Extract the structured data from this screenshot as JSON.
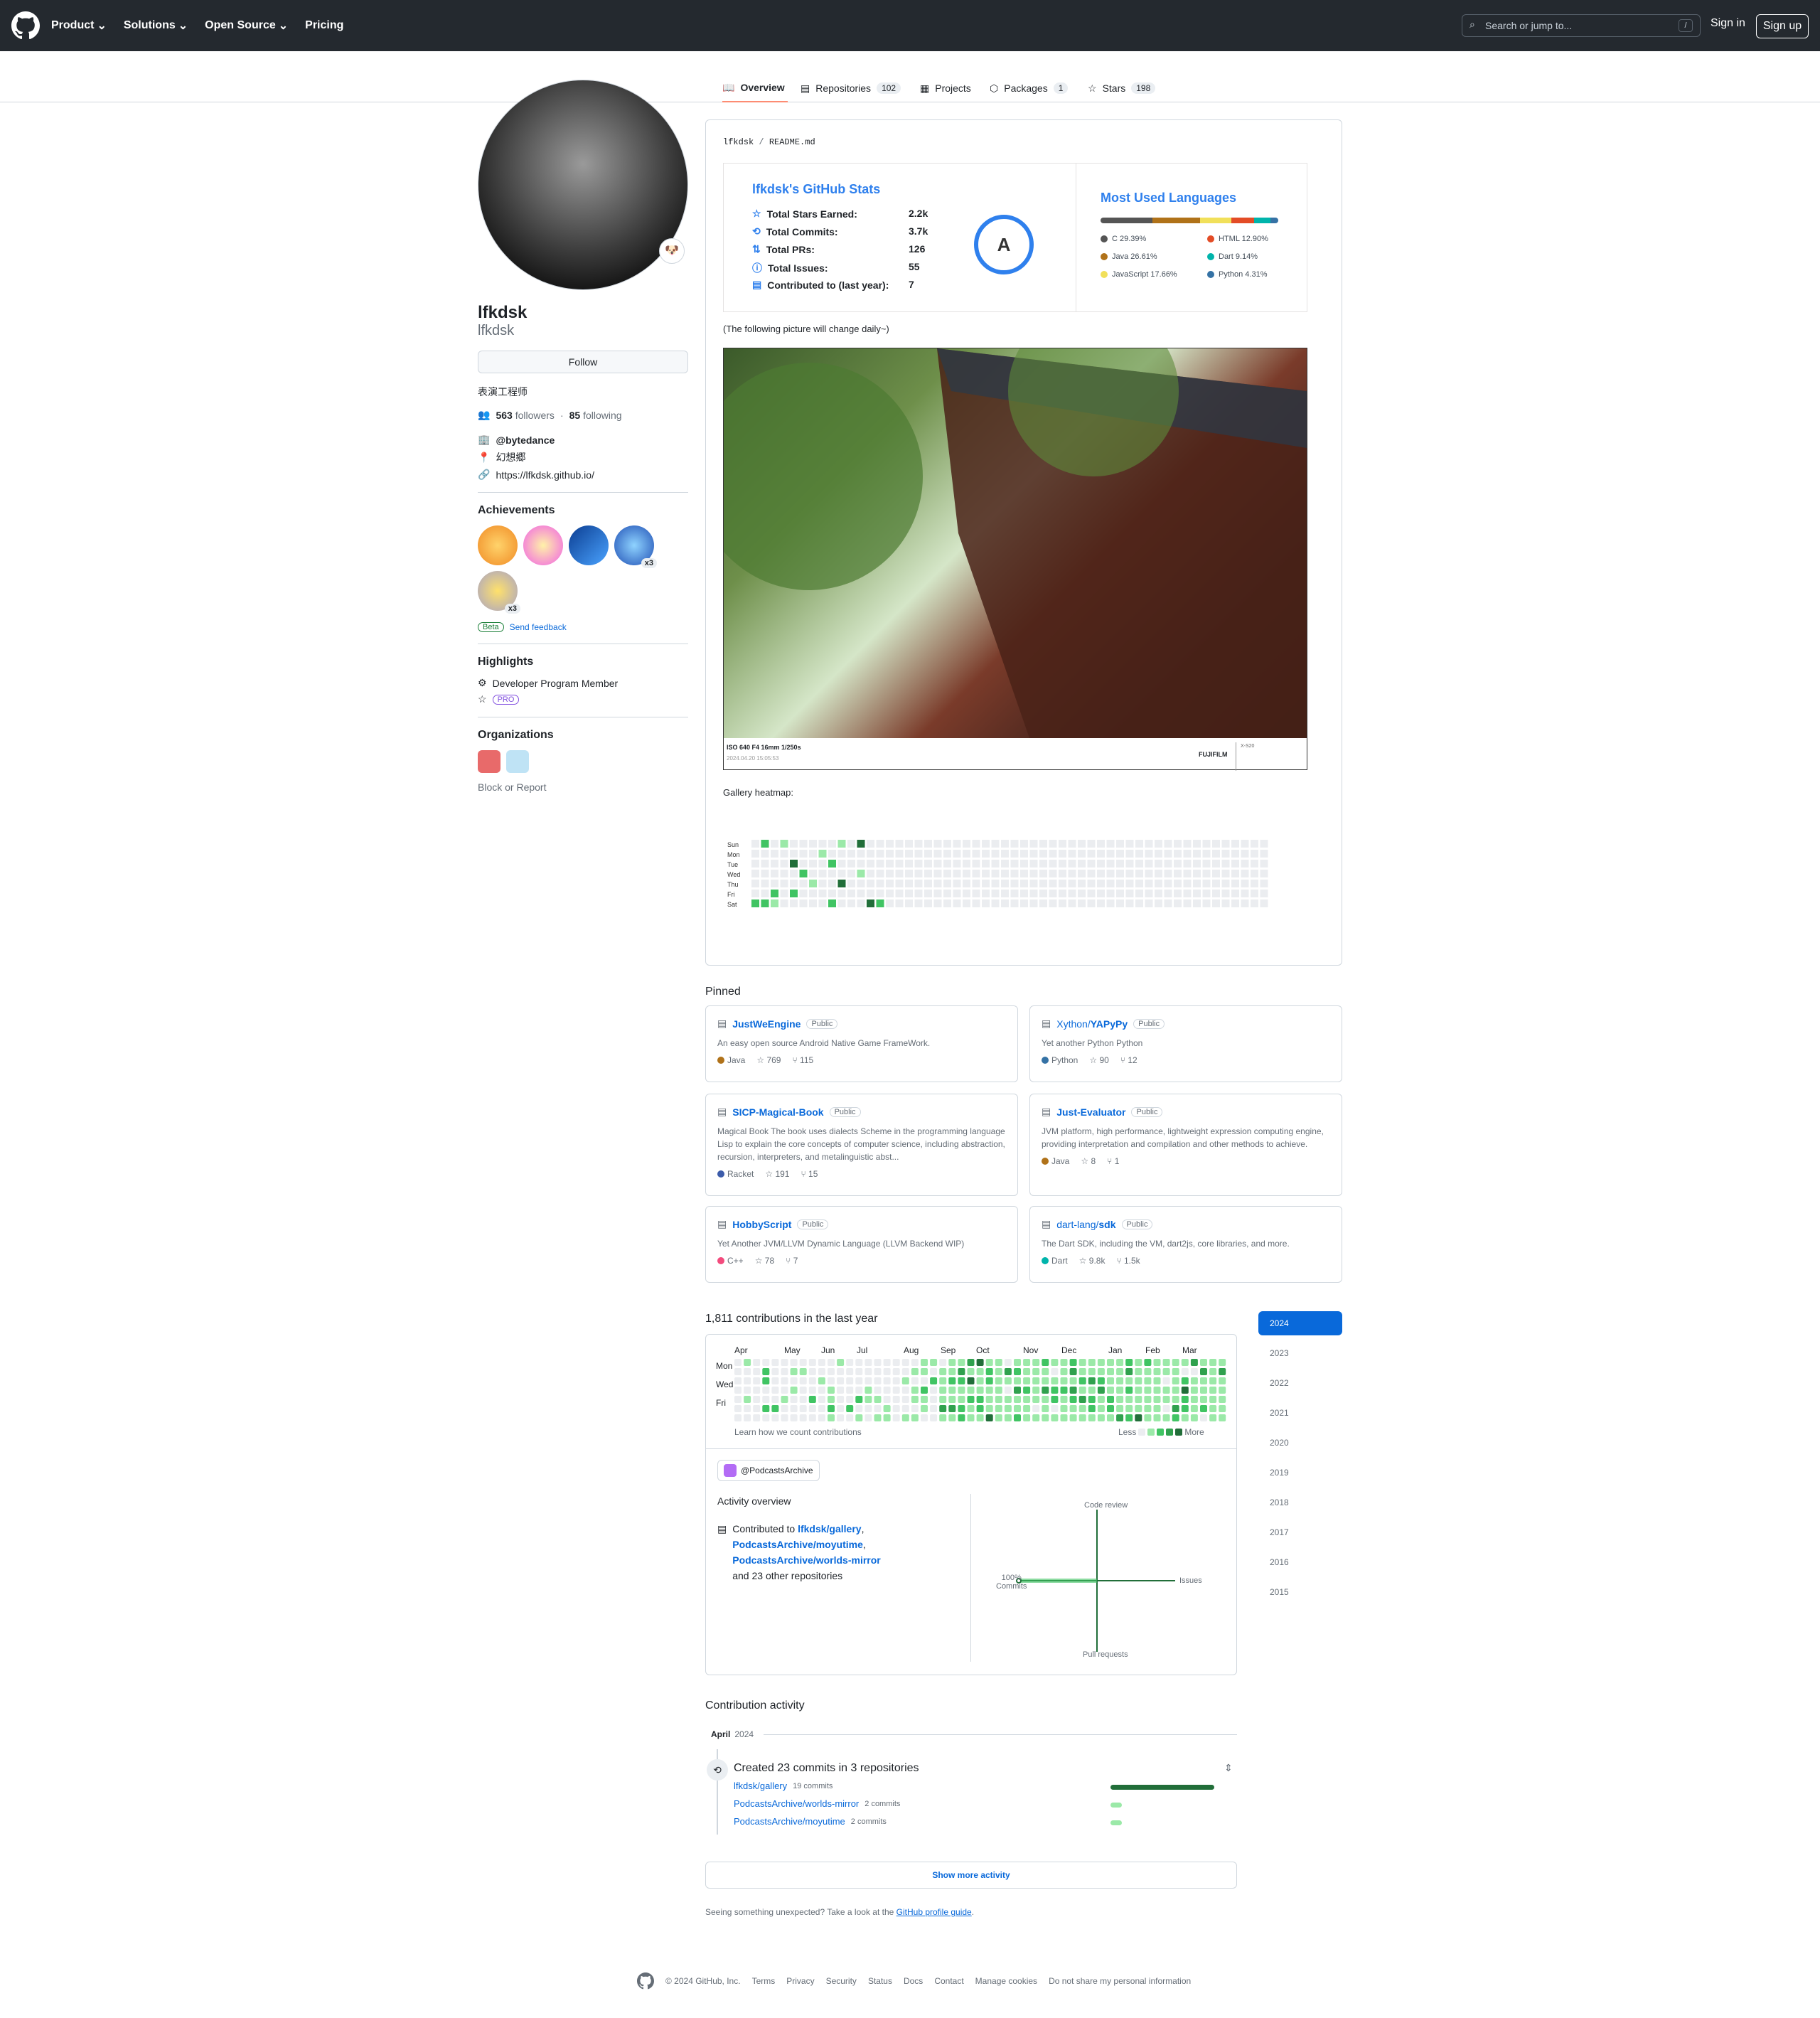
{
  "header": {
    "nav": [
      "Product",
      "Solutions",
      "Open Source",
      "Pricing"
    ],
    "search_placeholder": "Search or jump to...",
    "kbd": "/",
    "signin": "Sign in",
    "signup": "Sign up"
  },
  "tabs": [
    {
      "label": "Overview"
    },
    {
      "label": "Repositories",
      "count": "102"
    },
    {
      "label": "Projects"
    },
    {
      "label": "Packages",
      "count": "1"
    },
    {
      "label": "Stars",
      "count": "198"
    }
  ],
  "profile": {
    "name": "lfkdsk",
    "login": "lfkdsk",
    "follow": "Follow",
    "bio": "表演工程师",
    "followers": "563",
    "followers_label": "followers",
    "following": "85",
    "following_label": "following",
    "company": "@bytedance",
    "location": "幻想郷",
    "website": "https://lfkdsk.github.io/",
    "achievements_title": "Achievements",
    "beta": "Beta",
    "feedback": "Send feedback",
    "highlights_title": "Highlights",
    "highlight1": "Developer Program Member",
    "pro": "PRO",
    "orgs_title": "Organizations",
    "block": "Block or Report"
  },
  "readme": {
    "path_user": "lfkdsk",
    "path_sep": "/",
    "path_file": "README.md",
    "stats_title": "lfkdsk's GitHub Stats",
    "stats": [
      {
        "label": "Total Stars Earned:",
        "value": "2.2k"
      },
      {
        "label": "Total Commits:",
        "value": "3.7k"
      },
      {
        "label": "Total PRs:",
        "value": "126"
      },
      {
        "label": "Total Issues:",
        "value": "55"
      },
      {
        "label": "Contributed to (last year):",
        "value": "7"
      }
    ],
    "grade": "A",
    "langs_title": "Most Used Languages",
    "langs": [
      {
        "name": "C 29.39%",
        "color": "#555555"
      },
      {
        "name": "HTML 12.90%",
        "color": "#e34c26"
      },
      {
        "name": "Java 26.61%",
        "color": "#b07219"
      },
      {
        "name": "Dart 9.14%",
        "color": "#00b4ab"
      },
      {
        "name": "JavaScript 17.66%",
        "color": "#f1e05a"
      },
      {
        "name": "Python 4.31%",
        "color": "#3572A5"
      }
    ],
    "note": "(The following picture will change daily~)",
    "photo_caption": "ISO 640 F4 16mm 1/250s",
    "photo_date": "2024.04.20 15:05:53",
    "photo_brand": "FUJIFILM",
    "photo_model": "X-S20",
    "heatmap_title": "Gallery heatmap:",
    "days": [
      "Sun",
      "Mon",
      "Tue",
      "Wed",
      "Thu",
      "Fri",
      "Sat"
    ]
  },
  "pinned_title": "Pinned",
  "pinned": [
    {
      "owner": "",
      "repo": "JustWeEngine",
      "vis": "Public",
      "desc": "An easy open source Android Native Game FrameWork.",
      "lang": "Java",
      "lang_color": "#b07219",
      "stars": "769",
      "forks": "115"
    },
    {
      "owner": "Xython/",
      "repo": "YAPyPy",
      "vis": "Public",
      "desc": "Yet another Python Python",
      "lang": "Python",
      "lang_color": "#3572A5",
      "stars": "90",
      "forks": "12"
    },
    {
      "owner": "",
      "repo": "SICP-Magical-Book",
      "vis": "Public",
      "desc": "Magical Book The book uses dialects Scheme in the programming language Lisp to explain the core concepts of computer science, including abstraction, recursion, interpreters, and metalinguistic abst...",
      "lang": "Racket",
      "lang_color": "#3c5caa",
      "stars": "191",
      "forks": "15"
    },
    {
      "owner": "",
      "repo": "Just-Evaluator",
      "vis": "Public",
      "desc": "JVM platform, high performance, lightweight expression computing engine, providing interpretation and compilation and other methods to achieve.",
      "lang": "Java",
      "lang_color": "#b07219",
      "stars": "8",
      "forks": "1"
    },
    {
      "owner": "",
      "repo": "HobbyScript",
      "vis": "Public",
      "desc": "Yet Another JVM/LLVM Dynamic Language (LLVM Backend WIP)",
      "lang": "C++",
      "lang_color": "#f34b7d",
      "stars": "78",
      "forks": "7"
    },
    {
      "owner": "dart-lang/",
      "repo": "sdk",
      "vis": "Public",
      "desc": "The Dart SDK, including the VM, dart2js, core libraries, and more.",
      "lang": "Dart",
      "lang_color": "#00B4AB",
      "stars": "9.8k",
      "forks": "1.5k"
    }
  ],
  "contrib": {
    "title": "1,811 contributions in the last year",
    "months": [
      "Apr",
      "May",
      "Jun",
      "Jul",
      "Aug",
      "Sep",
      "Oct",
      "Nov",
      "Dec",
      "Jan",
      "Feb",
      "Mar"
    ],
    "days": [
      "Mon",
      "Wed",
      "Fri"
    ],
    "learn": "Learn how we count contributions",
    "less": "Less",
    "more": "More",
    "org": "@PodcastsArchive",
    "overview": "Activity overview",
    "contributed_to": "Contributed to",
    "repo1": "lfkdsk/gallery",
    "repo2": "PodcastsArchive/moyutime",
    "repo3": "PodcastsArchive/worlds-mirror",
    "others": "and 23 other repositories",
    "axis_top": "Code review",
    "axis_right": "Issues",
    "axis_bottom": "Pull requests",
    "axis_left_pct": "100%",
    "axis_left": "Commits"
  },
  "years": [
    "2024",
    "2023",
    "2022",
    "2021",
    "2020",
    "2019",
    "2018",
    "2017",
    "2016",
    "2015"
  ],
  "activity": {
    "title": "Contribution activity",
    "month": "April",
    "year": "2024",
    "created": "Created 23 commits in 3 repositories",
    "rows": [
      {
        "repo": "lfkdsk/gallery",
        "commits": "19 commits",
        "frac": 0.83
      },
      {
        "repo": "PodcastsArchive/worlds-mirror",
        "commits": "2 commits",
        "frac": 0.09
      },
      {
        "repo": "PodcastsArchive/moyutime",
        "commits": "2 commits",
        "frac": 0.09
      }
    ],
    "show_more": "Show more activity",
    "unexpected": "Seeing something unexpected? Take a look at the",
    "guide": "GitHub profile guide",
    "period": "."
  },
  "footer": {
    "copy": "© 2024 GitHub, Inc.",
    "links": [
      "Terms",
      "Privacy",
      "Security",
      "Status",
      "Docs",
      "Contact",
      "Manage cookies",
      "Do not share my personal information"
    ]
  }
}
